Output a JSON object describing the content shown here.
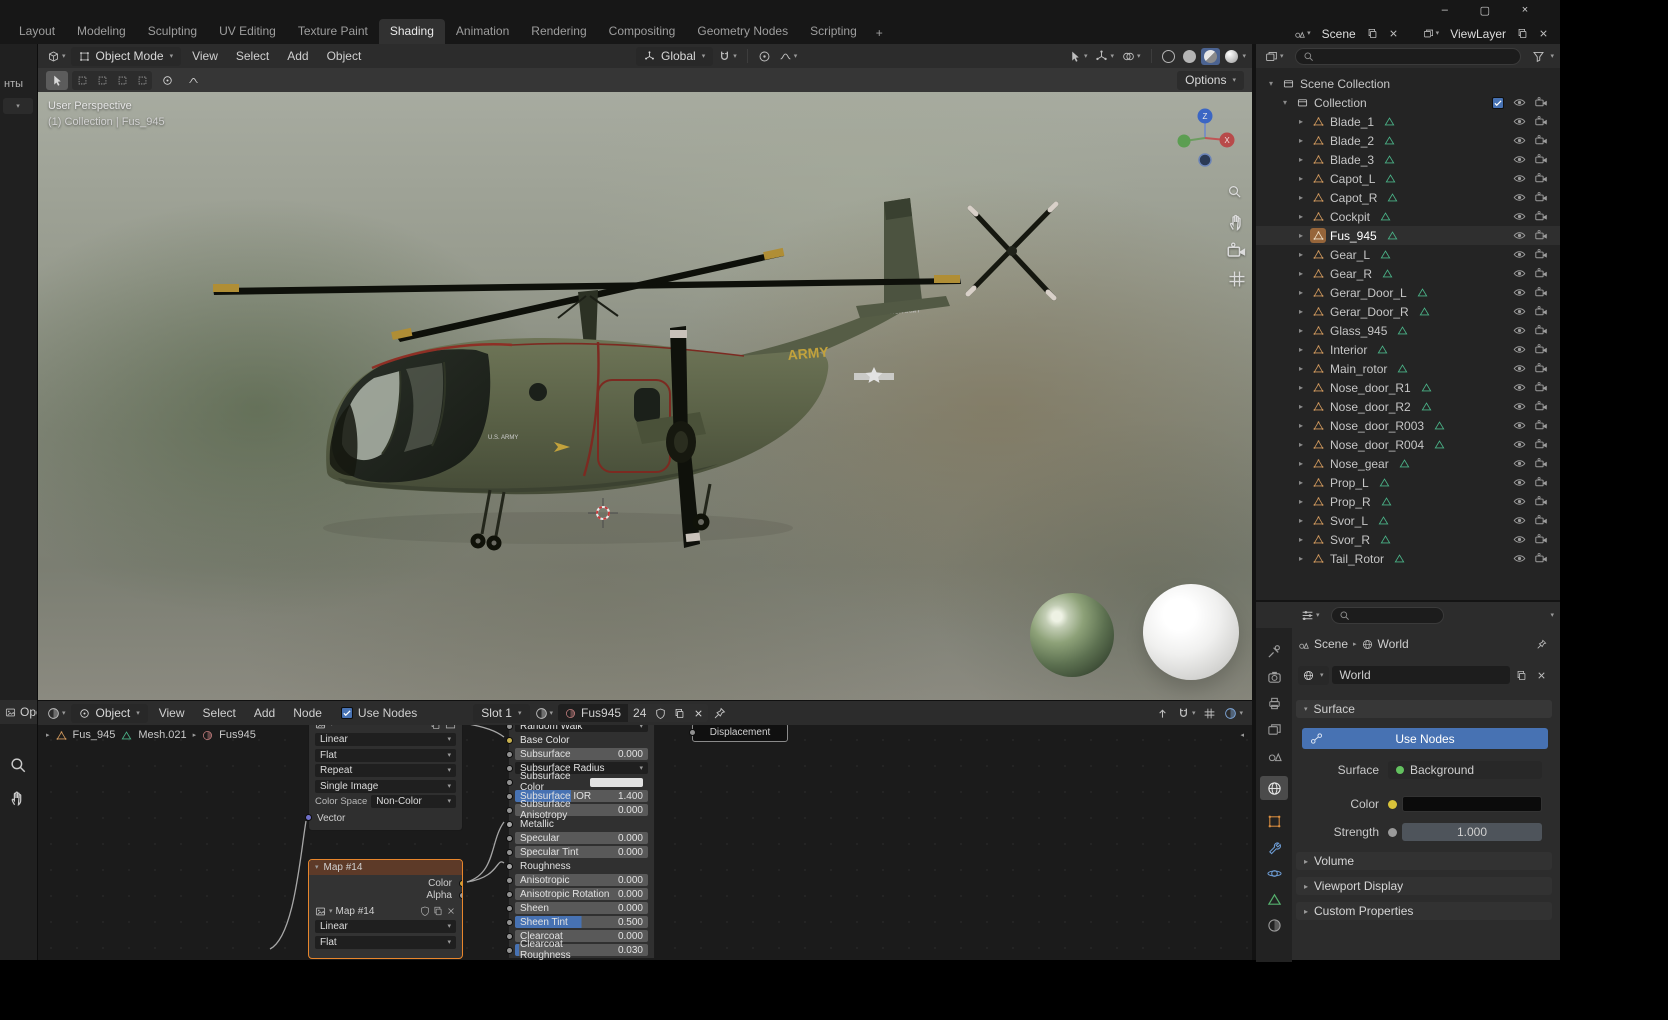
{
  "window": {
    "minimize": "–",
    "maximize": "▢",
    "close": "×"
  },
  "topbar": {
    "tabs": [
      {
        "label": "Layout"
      },
      {
        "label": "Modeling"
      },
      {
        "label": "Sculpting"
      },
      {
        "label": "UV Editing"
      },
      {
        "label": "Texture Paint"
      },
      {
        "label": "Shading",
        "active": true
      },
      {
        "label": "Animation"
      },
      {
        "label": "Rendering"
      },
      {
        "label": "Compositing"
      },
      {
        "label": "Geometry Nodes"
      },
      {
        "label": "Scripting"
      }
    ],
    "new_tab": "+",
    "scene": "Scene",
    "view_layer": "ViewLayer"
  },
  "viewport": {
    "mode": "Object Mode",
    "menus": [
      "View",
      "Select",
      "Add",
      "Object"
    ],
    "orientation": "Global",
    "options": "Options",
    "overlay": {
      "line1": "User Perspective",
      "line2": "(1) Collection | Fus_945"
    },
    "gizmo": {
      "x": "X",
      "z": "Z"
    }
  },
  "left_strip": {
    "top_label": "нты",
    "bottom_tab": "Ope"
  },
  "outliner": {
    "scene_collection": "Scene Collection",
    "collection": "Collection",
    "items": [
      {
        "name": "Blade_1"
      },
      {
        "name": "Blade_2"
      },
      {
        "name": "Blade_3"
      },
      {
        "name": "Capot_L"
      },
      {
        "name": "Capot_R"
      },
      {
        "name": "Cockpit"
      },
      {
        "name": "Fus_945",
        "selected": true
      },
      {
        "name": "Gear_L"
      },
      {
        "name": "Gear_R"
      },
      {
        "name": "Gerar_Door_L"
      },
      {
        "name": "Gerar_Door_R"
      },
      {
        "name": "Glass_945"
      },
      {
        "name": "Interior"
      },
      {
        "name": "Main_rotor"
      },
      {
        "name": "Nose_door_R1"
      },
      {
        "name": "Nose_door_R2"
      },
      {
        "name": "Nose_door_R003"
      },
      {
        "name": "Nose_door_R004"
      },
      {
        "name": "Nose_gear"
      },
      {
        "name": "Prop_L"
      },
      {
        "name": "Prop_R"
      },
      {
        "name": "Svor_L"
      },
      {
        "name": "Svor_R"
      },
      {
        "name": "Tail_Rotor"
      }
    ]
  },
  "properties": {
    "breadcrumb": {
      "scene": "Scene",
      "world": "World"
    },
    "world_name": "World",
    "surface_panel": "Surface",
    "use_nodes": "Use Nodes",
    "surface_label": "Surface",
    "surface_value": "Background",
    "color_label": "Color",
    "strength_label": "Strength",
    "strength_value": "1.000",
    "collapsed": [
      "Volume",
      "Viewport Display",
      "Custom Properties"
    ]
  },
  "shader": {
    "object_type": "Object",
    "menus": [
      "View",
      "Select",
      "Add",
      "Node"
    ],
    "use_nodes": "Use Nodes",
    "slot": "Slot 1",
    "material": "Fus945",
    "users": "24",
    "path": [
      "Fus_945",
      "Mesh.021",
      "Fus945"
    ],
    "displacement": "Displacement",
    "map13": {
      "dropdowns": [
        "Linear",
        "Flat",
        "Repeat",
        "Single Image"
      ],
      "color_space_label": "Color Space",
      "color_space_value": "Non-Color",
      "vector": "Vector"
    },
    "map14": {
      "title": "Map #14",
      "color_out": "Color",
      "alpha_out": "Alpha",
      "image": "Map #14",
      "dropdowns": [
        "Linear",
        "Flat"
      ]
    },
    "bsdf": [
      {
        "label": "Random Walk",
        "type": "dropdown"
      },
      {
        "label": "Base Color",
        "type": "linked",
        "socket": "#c8b14f"
      },
      {
        "label": "Subsurface",
        "value": "0.000",
        "type": "slider",
        "fill": 0
      },
      {
        "label": "Subsurface Radius",
        "type": "dropdown"
      },
      {
        "label": "Subsurface Color",
        "type": "color"
      },
      {
        "label": "Subsurface IOR",
        "value": "1.400",
        "type": "slider",
        "fill": 0.42
      },
      {
        "label": "Subsurface Anisotropy",
        "value": "0.000",
        "type": "slider",
        "fill": 0
      },
      {
        "label": "Metallic",
        "type": "linked",
        "socket": "#a8a8a8"
      },
      {
        "label": "Specular",
        "value": "0.000",
        "type": "slider",
        "fill": 0
      },
      {
        "label": "Specular Tint",
        "value": "0.000",
        "type": "slider",
        "fill": 0
      },
      {
        "label": "Roughness",
        "type": "linked",
        "socket": "#a8a8a8"
      },
      {
        "label": "Anisotropic",
        "value": "0.000",
        "type": "slider",
        "fill": 0
      },
      {
        "label": "Anisotropic Rotation",
        "value": "0.000",
        "type": "slider",
        "fill": 0
      },
      {
        "label": "Sheen",
        "value": "0.000",
        "type": "slider",
        "fill": 0
      },
      {
        "label": "Sheen Tint",
        "value": "0.500",
        "type": "slider",
        "fill": 0.5
      },
      {
        "label": "Clearcoat",
        "value": "0.000",
        "type": "slider",
        "fill": 0
      },
      {
        "label": "Clearcoat Roughness",
        "value": "0.030",
        "type": "slider",
        "fill": 0.03
      }
    ]
  },
  "colors": {
    "accent_blue": "#4772b3",
    "node_selected_orange": "#e8862c",
    "slider_blue": "#4772b3"
  }
}
